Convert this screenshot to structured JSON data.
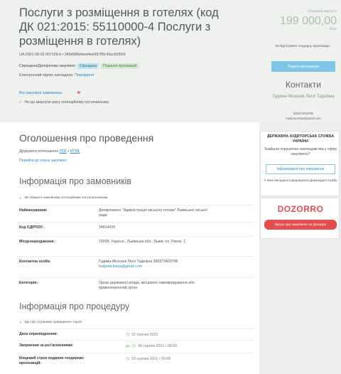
{
  "tender": {
    "title": "Послуги з розміщення в готелях (код ДК 021:2015: 55110000-4 Послуги з розміщення в готелях)",
    "id": "UA-2021-08-02-007159-b • 349d996efeed4ee997ff9c45ecf2d569",
    "procurement_type": "Спрощена/Допорогова закупівля",
    "tag_simplified": "Спрощена",
    "tag_status": "Подання пропозицій",
    "esign_text": "Електронний підпис накладено.",
    "esign_link": "Перевірити",
    "all_purchases": "Всі закупівлі замовника",
    "notify_text": "Не що звернути увагу потенційному постачальнику"
  },
  "price": {
    "label": "очікувана вартість",
    "value": "199 000,00",
    "currency": "UAH"
  },
  "sidebar": {
    "subscribe_text": "Як підготувати тендерну пропозицію",
    "offer_button": "Подати пропозицію",
    "contacts_title": "Контакти",
    "contact_name": "Гудима-Місенюк Леся Тадеївна",
    "contact_phone": "380973403788",
    "contact_email": "hudyma.lesya@gmail.com"
  },
  "announcement": {
    "title": "Оголошення про проведення",
    "print_label": "Друкувати оголошення",
    "print_pdf": "PDF",
    "print_sep": " • ",
    "print_html": "HTML",
    "plan_link": "Перейти до плану закупівлі"
  },
  "customer": {
    "title": "Інформація про замовників",
    "note": "Як обирати замовника потенційним постачальникам",
    "rows": [
      {
        "label": "Найменування:",
        "value": "Департамент \"Адміністрація міського голови\" Львівської міської ради"
      },
      {
        "label": "Код ЄДРПОУ:",
        "value": "34814439"
      },
      {
        "label": "Місцезнаходження:",
        "value": "79008, Україна , Львівська обл., Львів, пл. Ринок, 1"
      },
      {
        "label": "Контактна особа:",
        "value": "Гудима-Місенюк Леся Тадеївна 380973403788",
        "email": "hudyma.lesya@gmail.com"
      },
      {
        "label": "Категорія:",
        "value": "Орган державної влади, місцевого самоврядування або правоохоронний орган"
      }
    ]
  },
  "procedure": {
    "title": "Інформація про процедуру",
    "note": "Що про строками проведення торгів",
    "rows": [
      {
        "label": "Дата оприлюднення:",
        "prefix": "",
        "value": "02 серпня 2021"
      },
      {
        "label": "Звернення за роз'ясненнями:",
        "prefix": "до",
        "value": "06 серпня 2021 • 00:00"
      },
      {
        "label": "Кінцевий строк подання тендерних пропозицій:",
        "prefix": "",
        "value": "23 серпня 2021 • 00:00"
      }
    ]
  },
  "audit": {
    "title": "ДЕРЖАВНА АУДИТОРСЬКА СЛУЖБА УКРАЇНИ",
    "text": "Знайшли порушення законодавства у сфері закупівель?",
    "button": "Інформувати про порушення",
    "note": "У яких випадках інформувати Держаудитслужбу"
  },
  "dozorro": {
    "logo": "DOZORRO",
    "button": "Відгук про закупівлю на Дозорро"
  },
  "colors": {
    "accent": "#2b88c6",
    "button_blue": "#7cc6e6",
    "dozorro_red": "#e54d4d",
    "price_green": "#a8c4a8"
  }
}
